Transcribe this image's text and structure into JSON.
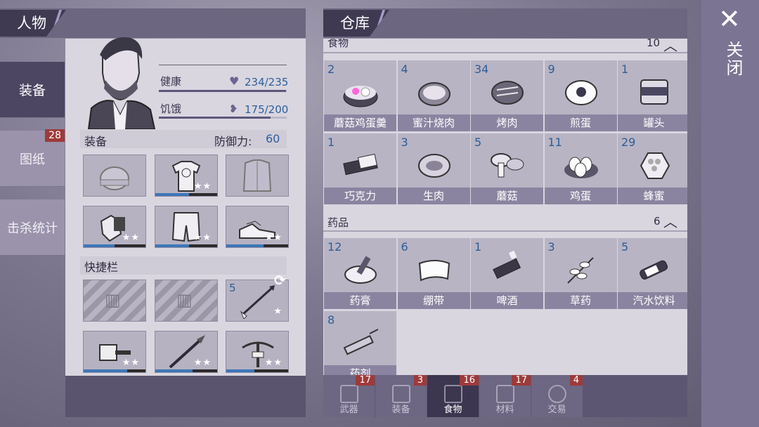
{
  "left_tabs": [
    {
      "label": "装备",
      "active": true
    },
    {
      "label": "图纸",
      "badge": "28"
    },
    {
      "label": "击杀统计"
    }
  ],
  "character": {
    "title": "人物",
    "health_label": "健康",
    "health_value": "234/235",
    "health_fraction": 0.996,
    "hunger_label": "饥饿",
    "hunger_value": "175/200",
    "hunger_fraction": 0.875,
    "equipment_label": "装备",
    "defense_label": "防御力:",
    "defense_value": "60",
    "equipment": [
      {
        "icon": "hat-icon",
        "stars": "",
        "durability": 0
      },
      {
        "icon": "tshirt-icon",
        "stars": "★★",
        "durability": 0.55
      },
      {
        "icon": "jacket-icon",
        "stars": "",
        "durability": 0
      },
      {
        "icon": "gloves-icon",
        "stars": "★★",
        "durability": 0.5
      },
      {
        "icon": "shorts-icon",
        "stars": "★★",
        "durability": 0.55
      },
      {
        "icon": "shoes-icon",
        "stars": "★★",
        "durability": 0.6
      }
    ],
    "quickbar_label": "快捷栏",
    "quickbar": [
      {
        "icon": "locked-slot",
        "locked": true
      },
      {
        "icon": "locked-slot",
        "locked": true
      },
      {
        "icon": "arrow-icon",
        "count": "5",
        "stars": "★"
      },
      {
        "icon": "cleaver-icon",
        "stars": "★★",
        "durability": 0.7
      },
      {
        "icon": "spear-icon",
        "stars": "★★",
        "durability": 0.6
      },
      {
        "icon": "crossbow-icon",
        "stars": "★★",
        "durability": 0.45
      }
    ]
  },
  "warehouse": {
    "title": "仓库",
    "food_label": "食物",
    "food_count": "10",
    "food": [
      {
        "count": "2",
        "name": "蘑菇鸡蛋羹",
        "icon": "mushroom-egg-soup-icon"
      },
      {
        "count": "4",
        "name": "蜜汁烧肉",
        "icon": "honey-roast-icon"
      },
      {
        "count": "34",
        "name": "烤肉",
        "icon": "roast-meat-icon"
      },
      {
        "count": "9",
        "name": "煎蛋",
        "icon": "fried-egg-icon"
      },
      {
        "count": "1",
        "name": "罐头",
        "icon": "canned-food-icon"
      },
      {
        "count": "1",
        "name": "巧克力",
        "icon": "chocolate-icon"
      },
      {
        "count": "3",
        "name": "生肉",
        "icon": "raw-meat-icon"
      },
      {
        "count": "5",
        "name": "蘑菇",
        "icon": "mushroom-icon"
      },
      {
        "count": "11",
        "name": "鸡蛋",
        "icon": "eggs-icon"
      },
      {
        "count": "29",
        "name": "蜂蜜",
        "icon": "honeycomb-icon"
      }
    ],
    "medicine_label": "药品",
    "medicine_count": "6",
    "medicine": [
      {
        "count": "12",
        "name": "药膏",
        "icon": "ointment-icon"
      },
      {
        "count": "6",
        "name": "绷带",
        "icon": "bandage-icon"
      },
      {
        "count": "1",
        "name": "啤酒",
        "icon": "beer-icon"
      },
      {
        "count": "3",
        "name": "草药",
        "icon": "herb-icon"
      },
      {
        "count": "5",
        "name": "汽水饮料",
        "icon": "soda-icon"
      },
      {
        "count": "8",
        "name": "药剂",
        "icon": "syringe-icon"
      }
    ],
    "tabs": [
      {
        "label": "武器",
        "badge": "17"
      },
      {
        "label": "装备",
        "badge": "3"
      },
      {
        "label": "食物",
        "badge": "16",
        "active": true
      },
      {
        "label": "材料",
        "badge": "17"
      },
      {
        "label": "交易",
        "badge": "4"
      }
    ]
  },
  "close": {
    "label": "关闭"
  }
}
